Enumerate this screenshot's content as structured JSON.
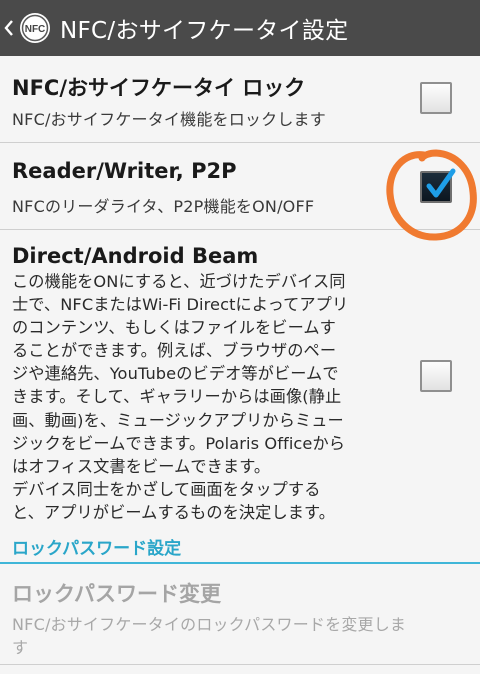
{
  "actionbar": {
    "title": "NFC/おサイフケータイ設定",
    "icon_label": "NFC"
  },
  "settings": [
    {
      "title": "NFC/おサイフケータイ ロック",
      "summary": "NFC/おサイフケータイ機能をロックします",
      "checked": false
    },
    {
      "title": "Reader/Writer, P2P",
      "summary": "NFCのリーダライタ、P2P機能をON/OFF",
      "checked": true
    },
    {
      "title": "Direct/Android Beam",
      "description": "この機能をONにすると、近づけたデバイス同\n士で、NFCまたはWi-Fi Directによってアプリ\nのコンテンツ、もしくはファイルをビームす\nることができます。例えば、ブラウザのペー\nジや連絡先、YouTubeのビデオ等がビームで\nきます。そして、ギャラリーからは画像(静止\n画、動画)を、ミュージックアプリからミュー\nジックをビームできます。Polaris Officeから\nはオフィス文書をビームできます。\nデバイス同士をかざして画面をタップする\nと、アプリがビームするものを決定します。",
      "checked": false
    }
  ],
  "section": {
    "header": "ロックパスワード設定"
  },
  "password_change": {
    "title": "ロックパスワード変更",
    "summary": "NFC/おサイフケータイのロックパスワードを変更しま",
    "summary_line2": "す",
    "enabled": false
  },
  "colors": {
    "actionbar": "#4a4a4a",
    "accent": "#2aa6c9",
    "check_mark": "#1e9ee8",
    "annotation": "#f07a30"
  }
}
